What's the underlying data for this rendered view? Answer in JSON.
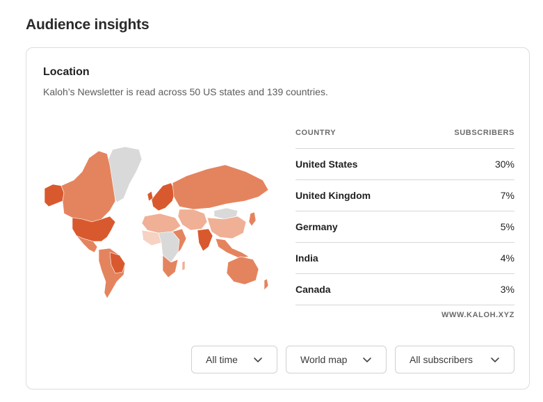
{
  "page": {
    "title": "Audience insights"
  },
  "location": {
    "title": "Location",
    "subtitle": "Kaloh’s Newsletter is read across 50 US states and 139 countries."
  },
  "table": {
    "col_country": "COUNTRY",
    "col_subscribers": "SUBSCRIBERS",
    "rows": [
      {
        "country": "United States",
        "subscribers": "30%"
      },
      {
        "country": "United Kingdom",
        "subscribers": "7%"
      },
      {
        "country": "Germany",
        "subscribers": "5%"
      },
      {
        "country": "India",
        "subscribers": "4%"
      },
      {
        "country": "Canada",
        "subscribers": "3%"
      }
    ],
    "source": "WWW.KALOH.XYZ"
  },
  "filters": {
    "time": "All time",
    "view": "World map",
    "audience": "All subscribers"
  },
  "colors": {
    "map_dark": "#d9592e",
    "map_mid": "#e4845e",
    "map_light": "#efb095",
    "map_pale": "#f6d2c3",
    "map_none": "#d9d9d9"
  }
}
